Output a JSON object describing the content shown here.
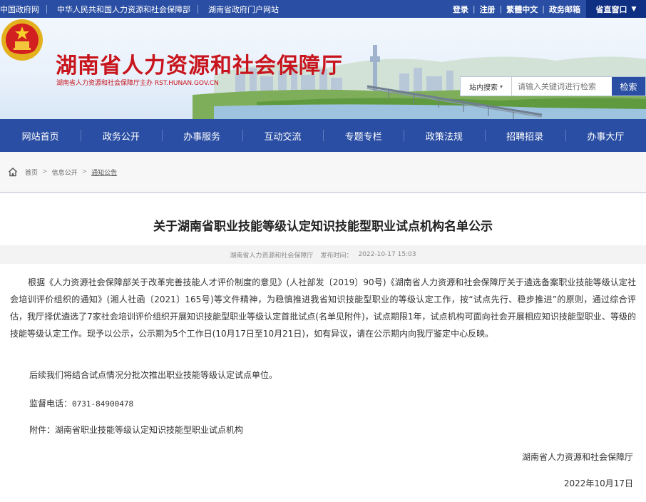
{
  "topbar": {
    "links": [
      "中国政府网",
      "中华人民共和国人力资源和社会保障部",
      "湖南省政府门户网站"
    ],
    "login": "登录",
    "register": "注册",
    "traditional": "繁體中文",
    "mail": "政务邮箱",
    "provincial_window": "省直窗口"
  },
  "header": {
    "site_title": "湖南省人力资源和社会保障厅",
    "site_sub": "湖南省人力资源和社会保障厅主办   RST.HUNAN.GOV.CN",
    "search_scope": "站内搜索",
    "search_placeholder": "请输入关键词进行检索",
    "search_button": "检索"
  },
  "nav": {
    "items": [
      "网站首页",
      "政务公开",
      "办事服务",
      "互动交流",
      "专题专栏",
      "政策法规",
      "招聘招录",
      "办事大厅"
    ]
  },
  "breadcrumb": {
    "items": [
      "首页",
      "信息公开",
      "通知公告"
    ]
  },
  "article": {
    "title": "关于湖南省职业技能等级认定知识技能型职业试点机构名单公示",
    "source": "湖南省人力资源和社会保障厅",
    "pub_label": "发布时间：",
    "pub_time": "2022-10-17 15:03",
    "para1": "根据《人力资源社会保障部关于改革完善技能人才评价制度的意见》(人社部发〔2019〕90号)《湖南省人力资源和社会保障厅关于遴选备案职业技能等级认定社会培训评价组织的通知》(湘人社函〔2021〕165号)等文件精神，为稳慎推进我省知识技能型职业的等级认定工作，按“试点先行、稳步推进”的原则，通过综合评估，我厅择优遴选了7家社会培训评价组织开展知识技能型职业等级认定首批试点(名单见附件)，试点期限1年，试点机构可面向社会开展相应知识技能型职业、等级的技能等级认定工作。现予以公示，公示期为5个工作日(10月17日至10月21日)，如有异议，请在公示期内向我厅鉴定中心反映。",
    "para2": "后续我们将结合试点情况分批次推出职业技能等级认定试点单位。",
    "phone_label": "监督电话：",
    "phone": "0731-84900478",
    "attachment": "附件：湖南省职业技能等级认定知识技能型职业试点机构",
    "signature": "湖南省人力资源和社会保障厅",
    "date": "2022年10月17日"
  },
  "colors": {
    "primary_blue": "#2a4ea3",
    "title_red": "#c8141c",
    "window_blue": "#0f2f82"
  },
  "icons": [
    "home-icon",
    "national-emblem-icon",
    "chevron-down-icon"
  ]
}
